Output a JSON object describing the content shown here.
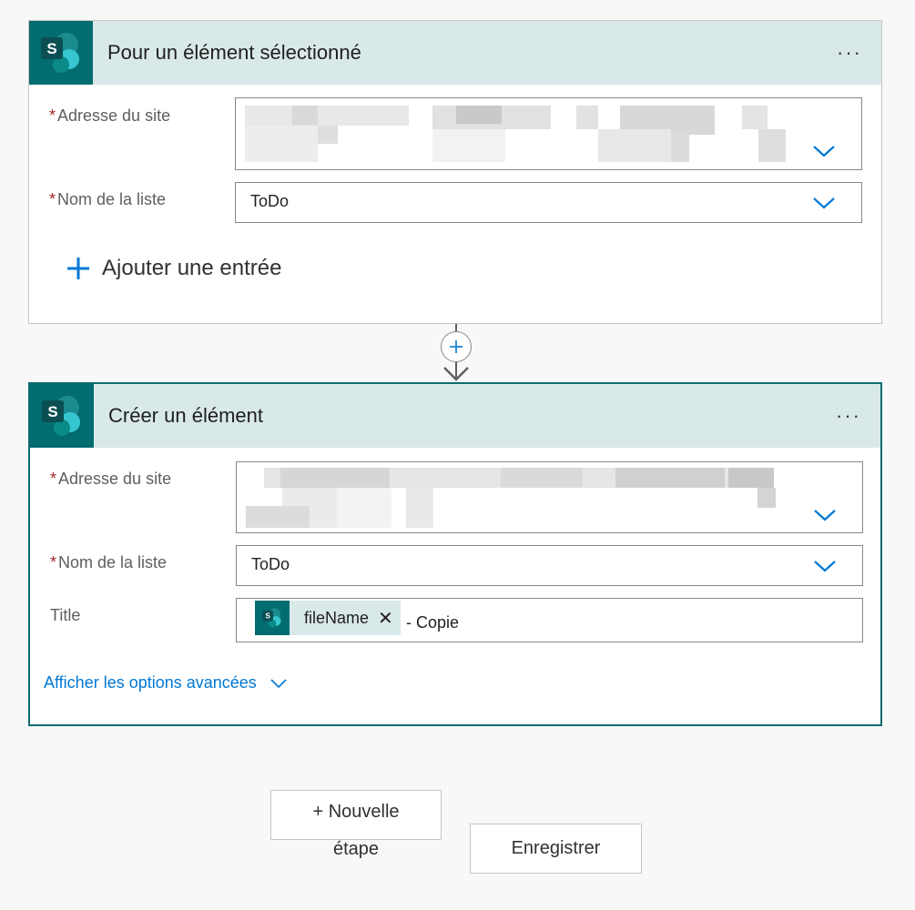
{
  "trigger": {
    "title": "Pour un élément sélectionné",
    "more_label": "···",
    "site_label": "Adresse du site",
    "list_label": "Nom de la liste",
    "list_value": "ToDo",
    "add_entry_label": "Ajouter une entrée",
    "required_mark": "*"
  },
  "action": {
    "title": "Créer un élément",
    "more_label": "···",
    "site_label": "Adresse du site",
    "list_label": "Nom de la liste",
    "list_value": "ToDo",
    "title_label": "Title",
    "token_label": "fileName",
    "token_remove": "✕",
    "title_suffix": "- Copie",
    "advanced_label": "Afficher les options avancées",
    "required_mark": "*"
  },
  "footer": {
    "new_step_line1": "+ Nouvelle",
    "new_step_line2": "étape",
    "save_label": "Enregistrer"
  },
  "icons": {
    "app": "sharepoint-icon",
    "add": "plus-icon",
    "dropdown": "chevron-down-icon",
    "insert": "insert-step-icon"
  },
  "colors": {
    "accent_blue": "#0078d4",
    "sharepoint_teal": "#036c70",
    "header_bg": "#d9e9e9",
    "active_border": "#0f6b6f",
    "required": "#a4262c"
  }
}
